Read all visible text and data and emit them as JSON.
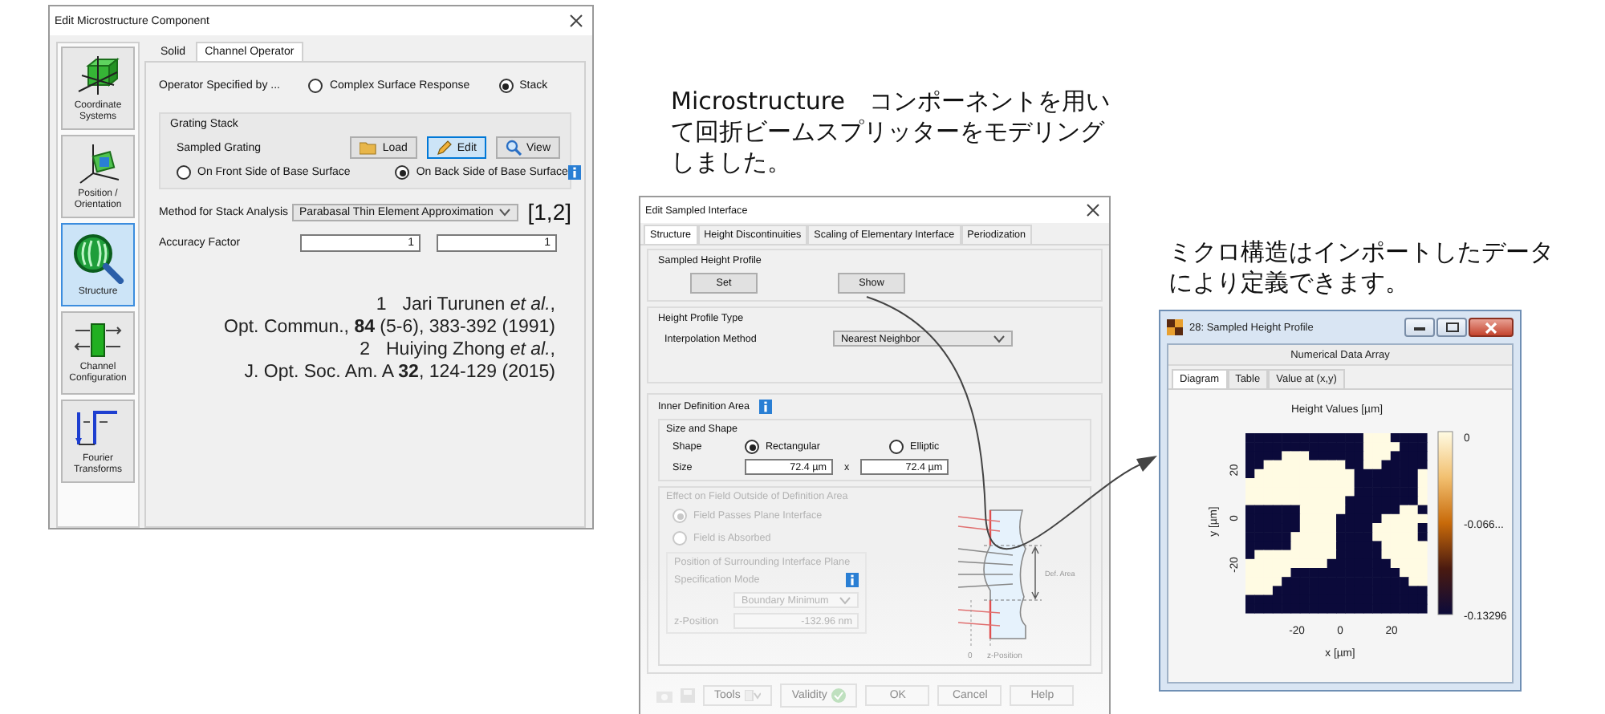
{
  "annotations": [
    {
      "text": "Microstructure　コンポーネントを用いて回折ビームスプリッターをモデリングしました。"
    },
    {
      "text": "ミクロ構造はインポートしたデータにより定義できます。"
    }
  ],
  "microstructure_dialog": {
    "title": "Edit Microstructure Component",
    "sidebar": [
      {
        "label": "Coordinate Systems",
        "selected": false
      },
      {
        "label": "Position / Orientation",
        "selected": false
      },
      {
        "label": "Structure",
        "selected": true
      },
      {
        "label": "Channel Configuration",
        "selected": false
      },
      {
        "label": "Fourier Transforms",
        "selected": false
      }
    ],
    "tabs": [
      {
        "label": "Solid",
        "selected": false
      },
      {
        "label": "Channel Operator",
        "selected": true
      }
    ],
    "operator": {
      "label": "Operator Specified by ...",
      "options": [
        {
          "label": "Complex Surface Response",
          "selected": false
        },
        {
          "label": "Stack",
          "selected": true
        }
      ]
    },
    "grating_stack": {
      "title": "Grating Stack",
      "label": "Sampled Grating",
      "buttons": [
        {
          "label": "Load",
          "selected": false
        },
        {
          "label": "Edit",
          "selected": true
        },
        {
          "label": "View",
          "selected": false
        }
      ],
      "sides": [
        {
          "label": "On Front Side of Base Surface",
          "selected": false
        },
        {
          "label": "On Back Side of Base Surface",
          "selected": true
        }
      ]
    },
    "method": {
      "label": "Method for Stack Analysis",
      "value": "Parabasal Thin Element Approximation",
      "reference": "[1,2]"
    },
    "accuracy": {
      "label": "Accuracy Factor",
      "values": [
        "1",
        "1"
      ]
    },
    "references": [
      {
        "number": "1",
        "author": "Jari Turunen *et al.*,",
        "source": "Opt. Commun., **84** (5-6), 383-392 (1991)"
      },
      {
        "number": "2",
        "author": "Huiying Zhong *et al.*,",
        "source": "J. Opt. Soc. Am. A **32**, 124-129 (2015)"
      }
    ]
  },
  "sampled_interface_dialog": {
    "title": "Edit Sampled Interface",
    "tabs": [
      {
        "label": "Structure",
        "selected": true
      },
      {
        "label": "Height Discontinuities",
        "selected": false
      },
      {
        "label": "Scaling of Elementary Interface",
        "selected": false
      },
      {
        "label": "Periodization",
        "selected": false
      }
    ],
    "height_profile": {
      "title": "Sampled Height Profile",
      "buttons": [
        "Set",
        "Show"
      ]
    },
    "profile_type": {
      "title": "Height Profile Type",
      "label": "Interpolation Method",
      "value": "Nearest Neighbor"
    },
    "inner_area": {
      "title": "Inner Definition Area",
      "size_shape": {
        "title": "Size and Shape",
        "shape_label": "Shape",
        "shapes": [
          {
            "label": "Rectangular",
            "selected": true
          },
          {
            "label": "Elliptic",
            "selected": false
          }
        ],
        "size_label": "Size",
        "size_values": [
          "72.4 µm",
          "72.4 µm"
        ],
        "separator": "x"
      }
    },
    "outside_effect": {
      "title": "Effect on Field Outside of Definition Area",
      "disabled": true,
      "options": [
        {
          "label": "Field Passes Plane Interface",
          "selected": true
        },
        {
          "label": "Field is Absorbed",
          "selected": false
        }
      ],
      "position": {
        "title": "Position of Surrounding Interface Plane",
        "mode_label": "Specification Mode",
        "mode_value": "Boundary Minimum",
        "z_label": "z-Position",
        "z_value": "-132.96 nm"
      },
      "diagram_labels": [
        "Def. Area",
        "0",
        "z-Position"
      ]
    },
    "footer_buttons": [
      {
        "label": "Tools",
        "kind": "menu"
      },
      {
        "label": "Validity",
        "kind": "status"
      },
      {
        "label": "OK",
        "kind": "plain"
      },
      {
        "label": "Cancel",
        "kind": "plain"
      },
      {
        "label": "Help",
        "kind": "plain"
      }
    ]
  },
  "height_profile_window": {
    "title": "28: Sampled Height Profile",
    "subtitle": "Numerical Data Array",
    "tabs": [
      {
        "label": "Diagram",
        "selected": true
      },
      {
        "label": "Table",
        "selected": false
      },
      {
        "label": "Value at (x,y)",
        "selected": false
      }
    ],
    "plot": {
      "title": "Height Values  [µm]",
      "x_label": "x [µm]",
      "y_label": "y [µm]",
      "x_ticks": [
        "-20",
        "0",
        "20"
      ],
      "y_ticks": [
        "20",
        "0",
        "-20"
      ],
      "colorbar_labels": [
        "0",
        "-0.066...",
        "-0.13296"
      ]
    }
  }
}
